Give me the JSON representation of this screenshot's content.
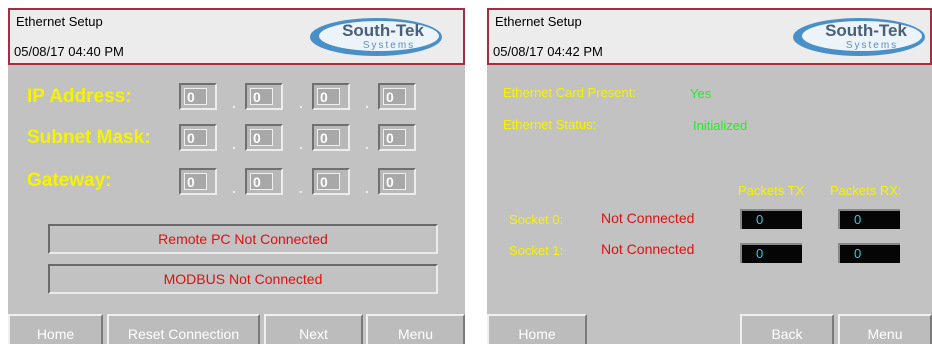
{
  "screen1": {
    "title": "Ethernet Setup",
    "datetime": "05/08/17  04:40 PM",
    "logo": {
      "name": "South-Tek",
      "sub": "Systems"
    },
    "fields": [
      {
        "label": "IP Address:",
        "octets": [
          "0",
          "0",
          "0",
          "0"
        ]
      },
      {
        "label": "Subnet Mask:",
        "octets": [
          "0",
          "0",
          "0",
          "0"
        ]
      },
      {
        "label": "Gateway:",
        "octets": [
          "0",
          "0",
          "0",
          "0"
        ]
      }
    ],
    "separator": ".",
    "status": [
      "Remote PC Not Connected",
      "MODBUS Not Connected"
    ],
    "buttons": [
      "Home",
      "Reset Connection",
      "Next",
      "Menu"
    ]
  },
  "screen2": {
    "title": "Ethernet Setup",
    "datetime": "05/08/17  04:42 PM",
    "logo": {
      "name": "South-Tek",
      "sub": "Systems"
    },
    "card_present_label": "Ethernet Card Present:",
    "card_present_value": "Yes",
    "status_label": "Ethernet Status:",
    "status_value": "Initialized",
    "packets_tx_header": "Packets TX",
    "packets_rx_header": "Packets RX:",
    "sockets": [
      {
        "label": "Socket 0:",
        "state": "Not Connected",
        "tx": "0",
        "rx": "0"
      },
      {
        "label": "Socket 1:",
        "state": "Not Connected",
        "tx": "0",
        "rx": "0"
      }
    ],
    "buttons": [
      "Home",
      "Back",
      "Menu"
    ]
  },
  "colors": {
    "background": "#c2c2c2",
    "label_yellow": "#f6f300",
    "value_green": "#22ee22",
    "status_red": "#e01010",
    "packet_cyan": "#21d8e0",
    "header_border": "#a03040"
  }
}
